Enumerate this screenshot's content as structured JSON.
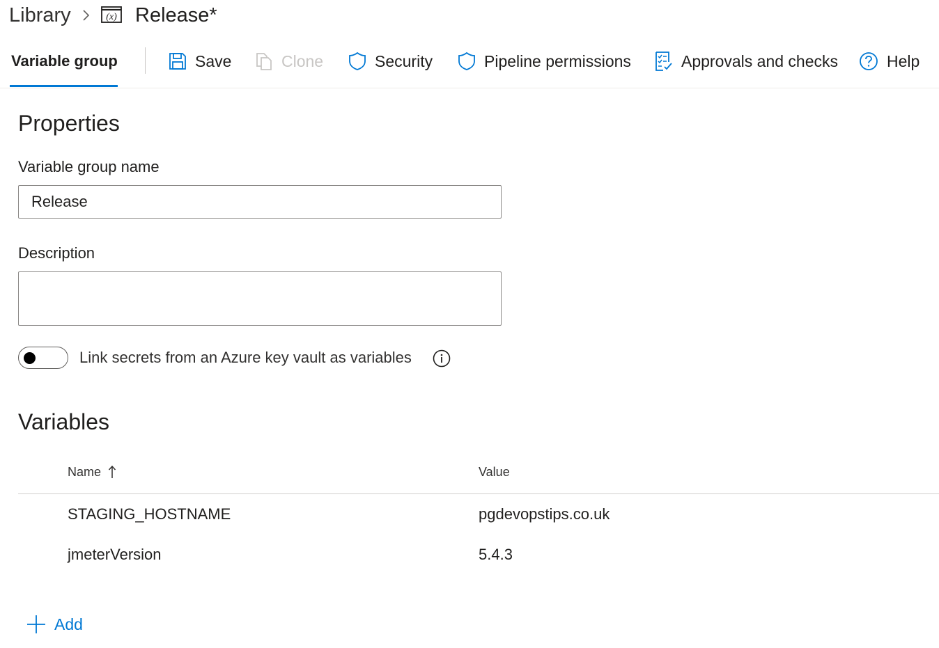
{
  "breadcrumb": {
    "root": "Library",
    "title": "Release*"
  },
  "toolbar": {
    "active_tab": "Variable group",
    "save": "Save",
    "clone": "Clone",
    "security": "Security",
    "pipeline_permissions": "Pipeline permissions",
    "approvals": "Approvals and checks",
    "help": "Help"
  },
  "properties": {
    "heading": "Properties",
    "name_label": "Variable group name",
    "name_value": "Release",
    "description_label": "Description",
    "description_value": "",
    "keyvault_toggle_label": "Link secrets from an Azure key vault as variables",
    "keyvault_toggle_on": false
  },
  "variables": {
    "heading": "Variables",
    "columns": {
      "name": "Name",
      "value": "Value"
    },
    "rows": [
      {
        "name": "STAGING_HOSTNAME",
        "value": "pgdevopstips.co.uk"
      },
      {
        "name": "jmeterVersion",
        "value": "5.4.3"
      }
    ],
    "add_label": "Add"
  },
  "colors": {
    "accent": "#0078d4",
    "disabled": "#c8c6c4"
  }
}
